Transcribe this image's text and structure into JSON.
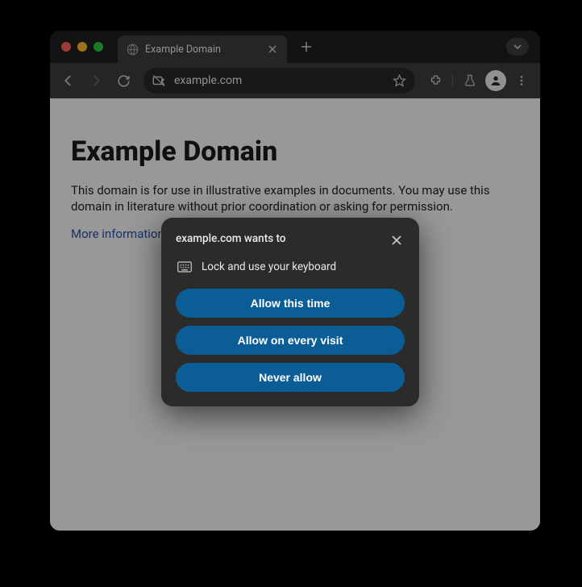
{
  "tab": {
    "title": "Example Domain"
  },
  "toolbar": {
    "url": "example.com"
  },
  "page": {
    "heading": "Example Domain",
    "paragraph": "This domain is for use in illustrative examples in documents. You may use this domain in literature without prior coordination or asking for permission.",
    "link_text": "More information..."
  },
  "dialog": {
    "title": "example.com wants to",
    "permission_text": "Lock and use your keyboard",
    "buttons": {
      "allow_once": "Allow this time",
      "allow_always": "Allow on every visit",
      "never": "Never allow"
    }
  }
}
